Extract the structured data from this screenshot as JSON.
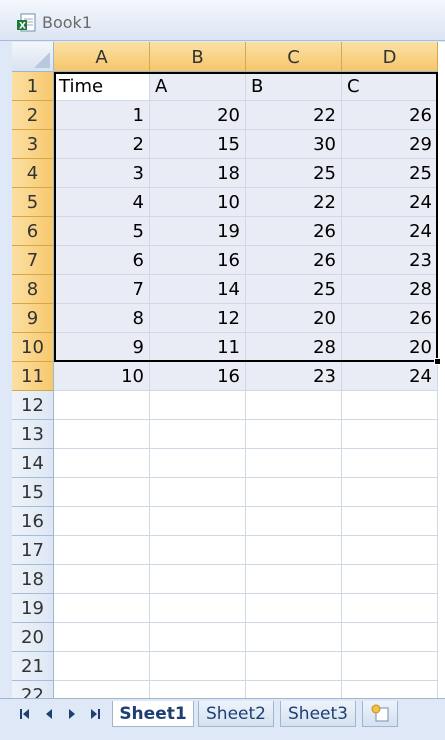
{
  "window": {
    "title": "Book1"
  },
  "columns": [
    "A",
    "B",
    "C",
    "D"
  ],
  "rows": [
    "1",
    "2",
    "3",
    "4",
    "5",
    "6",
    "7",
    "8",
    "9",
    "10",
    "11",
    "12",
    "13",
    "14",
    "15",
    "16",
    "17",
    "18",
    "19",
    "20",
    "21",
    "22"
  ],
  "header_row": [
    "Time",
    "A",
    "B",
    "C"
  ],
  "data_rows": [
    [
      "1",
      "20",
      "22",
      "26"
    ],
    [
      "2",
      "15",
      "30",
      "29"
    ],
    [
      "3",
      "18",
      "25",
      "25"
    ],
    [
      "4",
      "10",
      "22",
      "24"
    ],
    [
      "5",
      "19",
      "26",
      "24"
    ],
    [
      "6",
      "16",
      "26",
      "23"
    ],
    [
      "7",
      "14",
      "25",
      "28"
    ],
    [
      "8",
      "12",
      "20",
      "26"
    ],
    [
      "9",
      "11",
      "28",
      "20"
    ],
    [
      "10",
      "16",
      "23",
      "24"
    ]
  ],
  "sheet_tabs": [
    "Sheet1",
    "Sheet2",
    "Sheet3"
  ],
  "active_sheet": "Sheet1",
  "icons": {
    "app": "excel-workbook-icon",
    "nav": [
      "first-sheet-icon",
      "prev-sheet-icon",
      "next-sheet-icon",
      "last-sheet-icon"
    ],
    "insert": "insert-sheet-icon"
  },
  "colors": {
    "selected_header": "#f6c66b",
    "selection_fill": "#e9ebf5",
    "tab_text": "#1d3f73"
  }
}
